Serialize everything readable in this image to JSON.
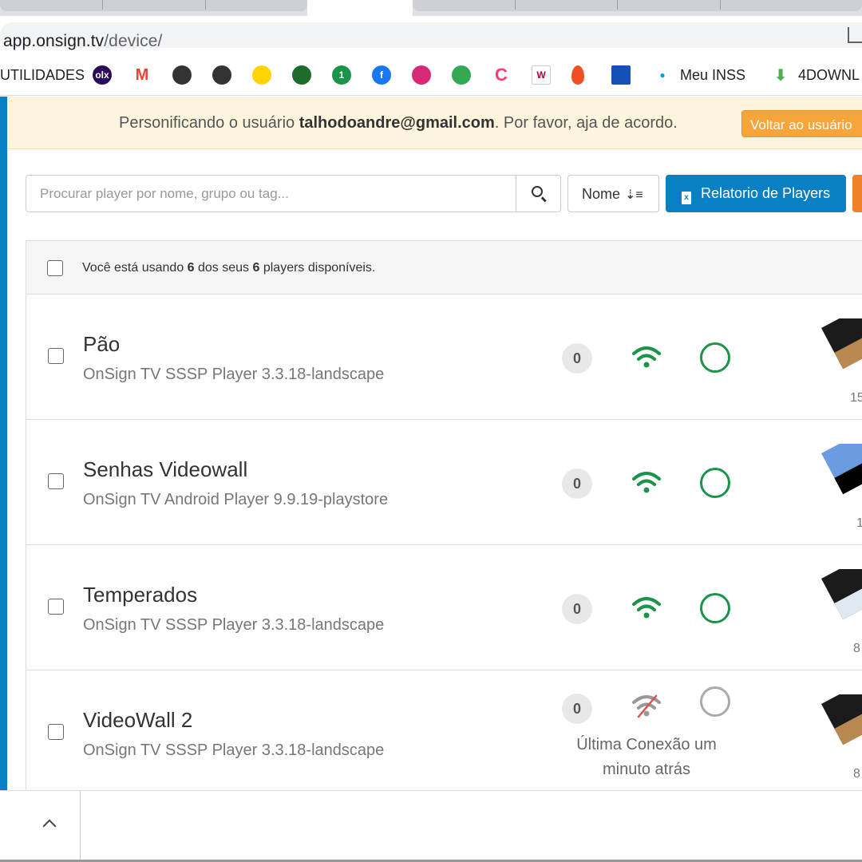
{
  "browser": {
    "url_host": "app.onsign.tv",
    "url_path": "/device/",
    "bookmarks": [
      {
        "label": "UTILIDADES",
        "icon": "folder-icon"
      },
      {
        "label": "olx",
        "icon": "olx-icon",
        "color": "#2b0a59"
      },
      {
        "label": "M",
        "icon": "gmail-icon",
        "color": "#ea4335"
      },
      {
        "label": "",
        "icon": "globe-icon",
        "color": "#333333"
      },
      {
        "label": "",
        "icon": "globe-icon",
        "color": "#333333"
      },
      {
        "label": "",
        "icon": "s-icon",
        "color": "#ffd400"
      },
      {
        "label": "",
        "icon": "crest-icon",
        "color": "#1e6b2d"
      },
      {
        "label": "1",
        "icon": "one-icon",
        "color": "#1a9448"
      },
      {
        "label": "f",
        "icon": "facebook-icon",
        "color": "#1877f2"
      },
      {
        "label": "",
        "icon": "instagram-icon",
        "color": "#d62976"
      },
      {
        "label": "",
        "icon": "drive-icon",
        "color": "#34a853"
      },
      {
        "label": "C",
        "icon": "c-icon",
        "color": "#ff3b6b"
      },
      {
        "label": "W",
        "icon": "w-icon",
        "color": "#b3003c"
      },
      {
        "label": "",
        "icon": "fire-icon",
        "color": "#f04e23"
      },
      {
        "label": "",
        "icon": "gov-icon",
        "color": "#1351b4"
      },
      {
        "label": "Meu INSS",
        "icon": "inss-icon",
        "color": "#00a0dc"
      },
      {
        "label": "4DOWNL",
        "icon": "download-icon",
        "color": "#4caf50"
      }
    ]
  },
  "impersonate": {
    "prefix": "Personificando o usuário ",
    "user": "talhodoandre@gmail.com",
    "suffix": ". Por favor, aja de acordo.",
    "back_label": "Voltar ao usuário"
  },
  "toolbar": {
    "search_placeholder": "Procurar player por nome, grupo ou tag...",
    "sort_label": "Nome",
    "report_label": "Relatorio de Players"
  },
  "usage": {
    "prefix": "Você está usando ",
    "used": "6",
    "middle": " dos seus ",
    "total": "6",
    "suffix": " players disponíveis."
  },
  "players": [
    {
      "name": "Pão",
      "version": "OnSign TV SSSP Player 3.3.18-landscape",
      "count": "0",
      "online": true,
      "duration": "15",
      "thumb_color": "#1b1b1b",
      "thumb_accent": "#b98850"
    },
    {
      "name": "Senhas Videowall",
      "version": "OnSign TV Android Player 9.9.19-playstore",
      "count": "0",
      "online": true,
      "duration": "1",
      "thumb_color": "#6b9be0",
      "thumb_accent": "#000000"
    },
    {
      "name": "Temperados",
      "version": "OnSign TV SSSP Player 3.3.18-landscape",
      "count": "0",
      "online": true,
      "duration": "8",
      "thumb_color": "#1b1b1b",
      "thumb_accent": "#dfe7f0"
    },
    {
      "name": "VideoWall 2",
      "version": "OnSign TV SSSP Player 3.3.18-landscape",
      "count": "0",
      "online": false,
      "last_connection": "Última Conexão um minuto atrás",
      "duration": "8",
      "thumb_color": "#1b1b1b",
      "thumb_accent": "#b98850"
    }
  ],
  "colors": {
    "online": "#1a9448",
    "offline": "#999999",
    "primary": "#0b7fc3",
    "warning": "#f7a43b"
  }
}
